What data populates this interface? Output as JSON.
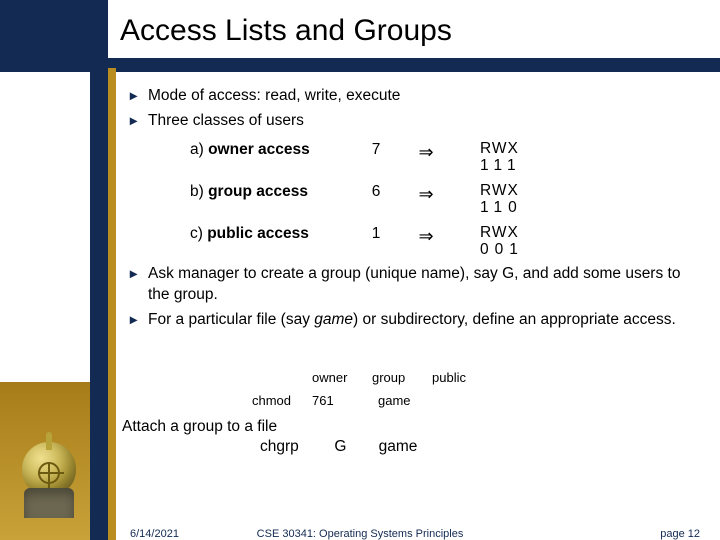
{
  "title": "Access Lists and Groups",
  "bullets": {
    "b1": "Mode of access:  read, write, execute",
    "b2": "Three classes of users",
    "b3": "Ask manager to create a group (unique name), say G, and add some users to the group.",
    "b4_pre": "For a particular file (say ",
    "b4_em": "game",
    "b4_post": ") or subdirectory, define an appropriate access."
  },
  "rows": [
    {
      "label_pre": "a) ",
      "label": "owner access",
      "n": "7",
      "arrow": "⇒",
      "rwx": "RWX",
      "bits": "111"
    },
    {
      "label_pre": "b) ",
      "label": "group access",
      "n": "6",
      "arrow": "⇒",
      "rwx": "RWX",
      "bits": "110"
    },
    {
      "label_pre": "c) ",
      "label": "public access",
      "n": "1",
      "arrow": "⇒",
      "rwx": "RWX",
      "bits": "001"
    }
  ],
  "mini": {
    "h1": "owner",
    "h2": "group",
    "h3": "public",
    "cmd": "chmod",
    "mode": "761",
    "file": "game"
  },
  "attach": {
    "line": "Attach a group to a file",
    "cmd": "chgrp",
    "grp": "G",
    "file": "game"
  },
  "footer": {
    "date": "6/14/2021",
    "course": "CSE 30341: Operating Systems Principles",
    "page": "page 12"
  },
  "marker": "▸"
}
